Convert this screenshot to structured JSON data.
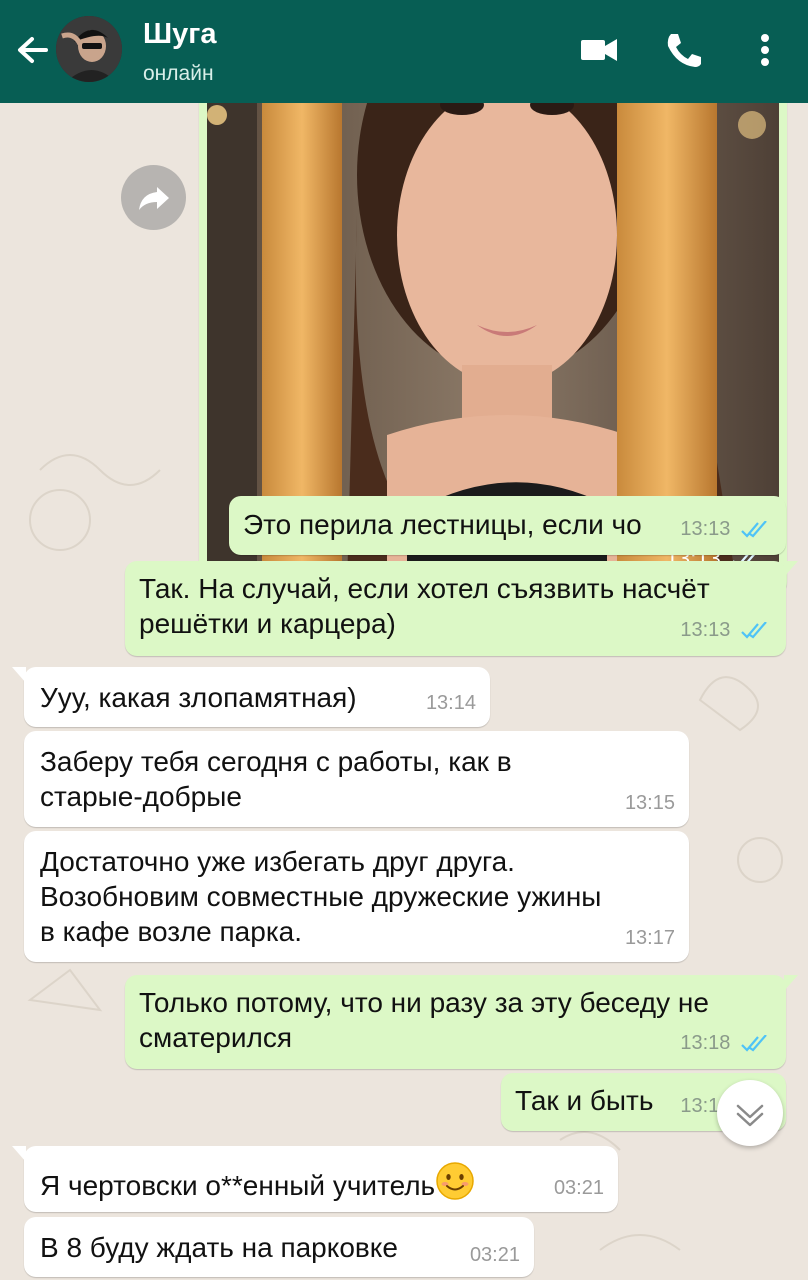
{
  "header": {
    "contact_name": "Шуга",
    "status": "онлайн"
  },
  "colors": {
    "header": "#075E54",
    "outgoing_bubble": "#DCF8C6",
    "incoming_bubble": "#FFFFFF",
    "read_ticks": "#4FC3F7",
    "chat_background": "#ECE5DD"
  },
  "icons": [
    "back-arrow-icon",
    "video-call-icon",
    "phone-icon",
    "more-vert-icon",
    "forward-icon",
    "scroll-down-icon",
    "read-ticks-icon",
    "smiling-face-emoji"
  ],
  "photo_message": {
    "time": "13:13",
    "status": "read"
  },
  "messages": [
    {
      "direction": "out",
      "text": "Это перила лестницы, если чо",
      "time": "13:13",
      "status": "read"
    },
    {
      "direction": "out",
      "text": "Так. На случай, если хотел съязвить насчёт\nрешётки и карцера)",
      "time": "13:13",
      "status": "read"
    },
    {
      "direction": "in",
      "text": "Ууу, какая злопамятная)",
      "time": "13:14"
    },
    {
      "direction": "in",
      "text": "Заберу тебя сегодня с работы, как в\nстарые-добрые",
      "time": "13:15"
    },
    {
      "direction": "in",
      "text": "Достаточно уже избегать друг друга.\nВозобновим совместные дружеские ужины\nв кафе возле парка.",
      "time": "13:17"
    },
    {
      "direction": "out",
      "text": "Только потому, что ни разу за эту беседу не\nсматерился",
      "time": "13:18",
      "status": "read"
    },
    {
      "direction": "out",
      "text": "Так и быть",
      "time": "13:18",
      "status": "read"
    },
    {
      "direction": "in",
      "text": "Я чертовски о**енный учитель",
      "time": "03:21",
      "emoji": "smiling-face"
    },
    {
      "direction": "in",
      "text": "В 8 буду ждать на парковке",
      "time": "03:21"
    }
  ]
}
